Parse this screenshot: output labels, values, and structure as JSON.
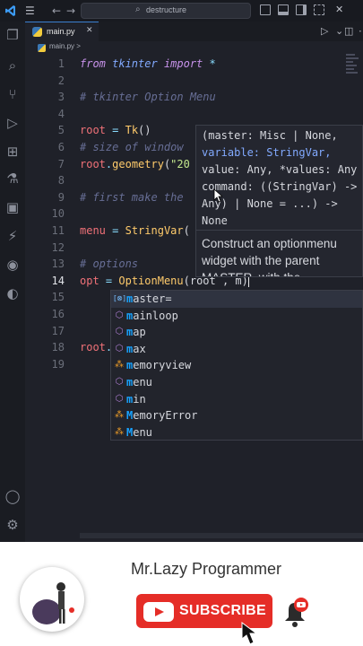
{
  "titlebar": {
    "search_text": "destructure",
    "nav_back": "←",
    "nav_forward": "→"
  },
  "tabs": [
    {
      "label": "main.py",
      "close": "✕"
    }
  ],
  "tab_tools": {
    "run": "▷",
    "split": "◫",
    "more": "⋯"
  },
  "breadcrumb": {
    "file": "main.py >"
  },
  "line_numbers": [
    "1",
    "2",
    "3",
    "4",
    "5",
    "6",
    "7",
    "8",
    "9",
    "10",
    "11",
    "12",
    "13",
    "14",
    "15",
    "16",
    "17",
    "18",
    "19"
  ],
  "active_line": "14",
  "code": {
    "l1": {
      "kw1": "from",
      "mod": " tkinter ",
      "kw2": "import",
      "star": " *"
    },
    "l3": "# tkinter Option Menu",
    "l5": {
      "var": "root",
      "eq": " = ",
      "fn": "Tk",
      "paren": "()"
    },
    "l6": "# size of window",
    "l7": {
      "var": "root",
      "dot": ".",
      "fn": "geometry",
      "paren": "(",
      "str": "\"20"
    },
    "l9": "# first make the",
    "l11": {
      "var": "menu",
      "eq": " = ",
      "fn": "StringVar",
      "paren": "("
    },
    "l13": "# options",
    "l14": {
      "var": "opt",
      "eq": " = ",
      "fn": "OptionMenu",
      "args": "(root , m)"
    },
    "l18": {
      "var": "root",
      "dot": "."
    }
  },
  "hover": {
    "sig_line1": "(master: Misc | None,",
    "sig_line2": "variable: StringVar,",
    "sig_line3": "value: Any, *values: Any",
    "sig_line4": "command: ((StringVar) ->",
    "sig_line5": "Any) | None = ...) ->",
    "sig_line6": "None",
    "doc": "Construct an optionmenu widget with the parent MASTER, with the"
  },
  "suggestions": [
    {
      "kind": "var",
      "icon": "[⊗]",
      "match": "m",
      "rest": "aster="
    },
    {
      "kind": "fn",
      "icon": "⬡",
      "match": "m",
      "rest": "ainloop"
    },
    {
      "kind": "fn",
      "icon": "⬡",
      "match": "m",
      "rest": "ap"
    },
    {
      "kind": "fn",
      "icon": "⬡",
      "match": "m",
      "rest": "ax"
    },
    {
      "kind": "cls",
      "icon": "⁂",
      "match": "m",
      "rest": "emoryview"
    },
    {
      "kind": "fn",
      "icon": "⬡",
      "match": "m",
      "rest": "enu"
    },
    {
      "kind": "fn",
      "icon": "⬡",
      "match": "m",
      "rest": "in"
    },
    {
      "kind": "cls",
      "icon": "⁂",
      "match": "M",
      "rest": "emoryError"
    },
    {
      "kind": "cls",
      "icon": "⁂",
      "match": "M",
      "rest": "enu"
    }
  ],
  "footer": {
    "channel_name": "Mr.Lazy Programmer",
    "subscribe_label": "SUBSCRIBE"
  },
  "colors": {
    "editor_bg": "#1f2129",
    "accent": "#3c7fd1",
    "subscribe_red": "#e52d27"
  }
}
